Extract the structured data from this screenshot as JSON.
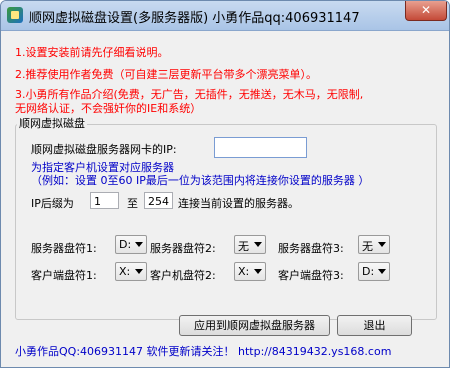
{
  "window": {
    "title": "顺网虚拟磁盘设置(多服务器版) 小勇作品qq:406931147",
    "close_label": "✕"
  },
  "intro": {
    "line1": "1.设置安装前请先仔细看说明。",
    "line2": "2.推荐使用作者免费（可自建三层更新平台带多个漂亮菜单）。",
    "line3": "3.小勇所有作品介绍(免费，无广告，无插件，无推送，无木马，无限制,",
    "line4": "无网络认证，不会强奸你的IE和系统）"
  },
  "group": {
    "title": "顺网虚拟磁盘",
    "ip_label": "顺网虚拟磁盘服务器网卡的IP:",
    "ip_value": "",
    "hint1": "为指定客户机设置对应服务器",
    "hint2": "（例如：设置 0至60 IP最后一位为该范围内将连接你设置的服务器 ）",
    "suffix_label": "IP后缀为",
    "suffix_from": "1",
    "to_label": "至",
    "suffix_to": "254",
    "suffix_after": "连接当前设置的服务器。",
    "server_drive1_label": "服务器盘符1:",
    "server_drive1": "D:",
    "server_drive2_label": "服务器盘符2:",
    "server_drive2": "无",
    "server_drive3_label": "服务器盘符3:",
    "server_drive3": "无",
    "client_drive1_label": "客户端盘符1:",
    "client_drive1": "X:",
    "client_drive2_label": "客户机盘符2:",
    "client_drive2": "X:",
    "client_drive3_label": "客户端盘符3:",
    "client_drive3": "D:"
  },
  "buttons": {
    "apply": "应用到顺网虚拟盘服务器",
    "exit": "退出"
  },
  "footer": {
    "text": "小勇作品QQ:406931147  软件更新请关注！ http://84319432.ys168.com"
  }
}
